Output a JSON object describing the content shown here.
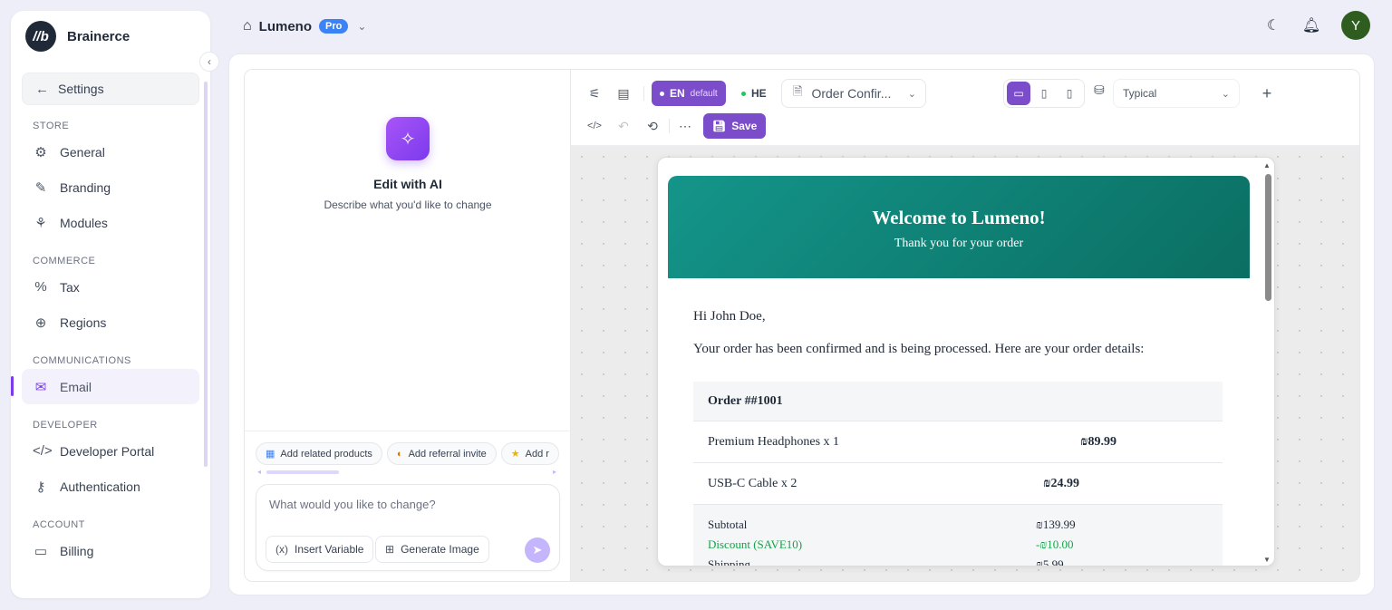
{
  "brand": {
    "name": "Brainerce",
    "logo_text": "//b"
  },
  "sidebar": {
    "back_label": "Settings",
    "sections": [
      {
        "title": "STORE",
        "items": [
          {
            "label": "General",
            "icon": "gear-icon"
          },
          {
            "label": "Branding",
            "icon": "brush-icon"
          },
          {
            "label": "Modules",
            "icon": "modules-icon"
          }
        ]
      },
      {
        "title": "COMMERCE",
        "items": [
          {
            "label": "Tax",
            "icon": "percent-icon"
          },
          {
            "label": "Regions",
            "icon": "globe-icon"
          }
        ]
      },
      {
        "title": "COMMUNICATIONS",
        "items": [
          {
            "label": "Email",
            "icon": "mail-icon",
            "active": true
          }
        ]
      },
      {
        "title": "DEVELOPER",
        "items": [
          {
            "label": "Developer Portal",
            "icon": "code-icon"
          },
          {
            "label": "Authentication",
            "icon": "key-icon"
          }
        ]
      },
      {
        "title": "ACCOUNT",
        "items": [
          {
            "label": "Billing",
            "icon": "credit-card-icon"
          }
        ]
      }
    ]
  },
  "header": {
    "store_name": "Lumeno",
    "plan_badge": "Pro",
    "avatar_initial": "Y"
  },
  "ai_panel": {
    "title": "Edit with AI",
    "subtitle": "Describe what you'd like to change",
    "suggestions": [
      {
        "label": "Add related products",
        "icon": "package-icon"
      },
      {
        "label": "Add referral invite",
        "icon": "handshake-icon"
      },
      {
        "label": "Add r",
        "icon": "star-icon"
      }
    ],
    "prompt_placeholder": "What would you like to change?",
    "insert_variable_label": "Insert Variable",
    "generate_image_label": "Generate Image"
  },
  "toolbar": {
    "lang_en": "EN",
    "lang_en_tag": "default",
    "lang_he": "HE",
    "template_name": "Order Confir...",
    "preset": "Typical",
    "save_label": "Save",
    "accent_color": "#7c4dca"
  },
  "email": {
    "heading": "Welcome to Lumeno!",
    "subheading": "Thank you for your order",
    "greeting": "Hi John Doe,",
    "intro": "Your order has been confirmed and is being processed. Here are your order details:",
    "order_title": "Order ##1001",
    "items": [
      {
        "name": "Premium Headphones x 1",
        "price": "₪89.99"
      },
      {
        "name": "USB-C Cable x 2",
        "price": "₪24.99"
      }
    ],
    "subtotal_label": "Subtotal",
    "subtotal_value": "₪139.99",
    "discount_label": "Discount (SAVE10)",
    "discount_value": "-₪10.00",
    "shipping_label": "Shipping",
    "shipping_value": "₪5.99",
    "header_color": "#0f8074"
  }
}
